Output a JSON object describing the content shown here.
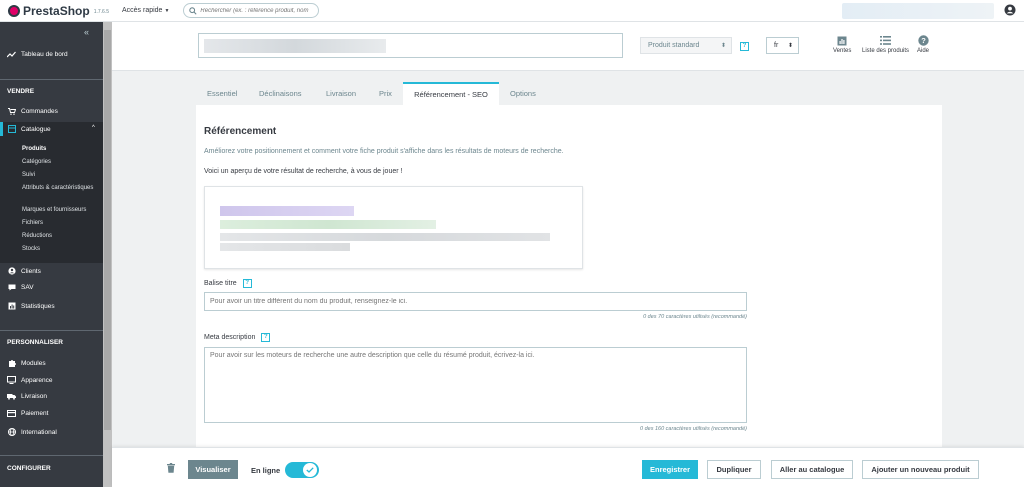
{
  "header": {
    "brand": "PrestaShop",
    "version": "1.7.6.5",
    "quick_access": "Accès rapide",
    "search_placeholder": "Rechercher (ex. : référence produit, nom"
  },
  "sidebar": {
    "dashboard": "Tableau de bord",
    "section_sell": "VENDRE",
    "orders": "Commandes",
    "catalog": "Catalogue",
    "catalog_items": [
      "Produits",
      "Catégories",
      "Suivi",
      "Attributs & caractéristiques",
      "Marques et fournisseurs",
      "Fichiers",
      "Réductions",
      "Stocks"
    ],
    "customers": "Clients",
    "support": "SAV",
    "stats": "Statistiques",
    "section_customize": "PERSONNALISER",
    "modules": "Modules",
    "appearance": "Apparence",
    "shipping": "Livraison",
    "payment": "Paiement",
    "international": "International",
    "section_configure": "CONFIGURER"
  },
  "product_header": {
    "type_select": "Produit standard",
    "lang_select": "fr",
    "tools": {
      "sales": "Ventes",
      "product_list": "Liste des produits",
      "help": "Aide"
    }
  },
  "tabs": [
    "Essentiel",
    "Déclinaisons",
    "Livraison",
    "Prix",
    "Référencement - SEO",
    "Options"
  ],
  "seo": {
    "title": "Référencement",
    "description": "Améliorez votre positionnement et comment votre fiche produit s'affiche dans les résultats de moteurs de recherche.",
    "preview_label": "Voici un aperçu de votre résultat de recherche, à vous de jouer !",
    "meta_title_label": "Balise titre",
    "meta_title_placeholder": "Pour avoir un titre différent du nom du produit, renseignez-le ici.",
    "meta_title_counter": "0 des 70 caractères utilisés (recommandé)",
    "meta_desc_label": "Meta description",
    "meta_desc_placeholder": "Pour avoir sur les moteurs de recherche une autre description que celle du résumé produit, écrivez-la ici.",
    "meta_desc_counter": "0 des 160 caractères utilisés (recommandé)"
  },
  "footer": {
    "preview": "Visualiser",
    "online": "En ligne",
    "save": "Enregistrer",
    "duplicate": "Dupliquer",
    "go_catalog": "Aller au catalogue",
    "add_new": "Ajouter un nouveau produit"
  },
  "colors": {
    "accent": "#25b9d7",
    "sidebar_bg": "#363a41",
    "brand_pink": "#df0067"
  }
}
